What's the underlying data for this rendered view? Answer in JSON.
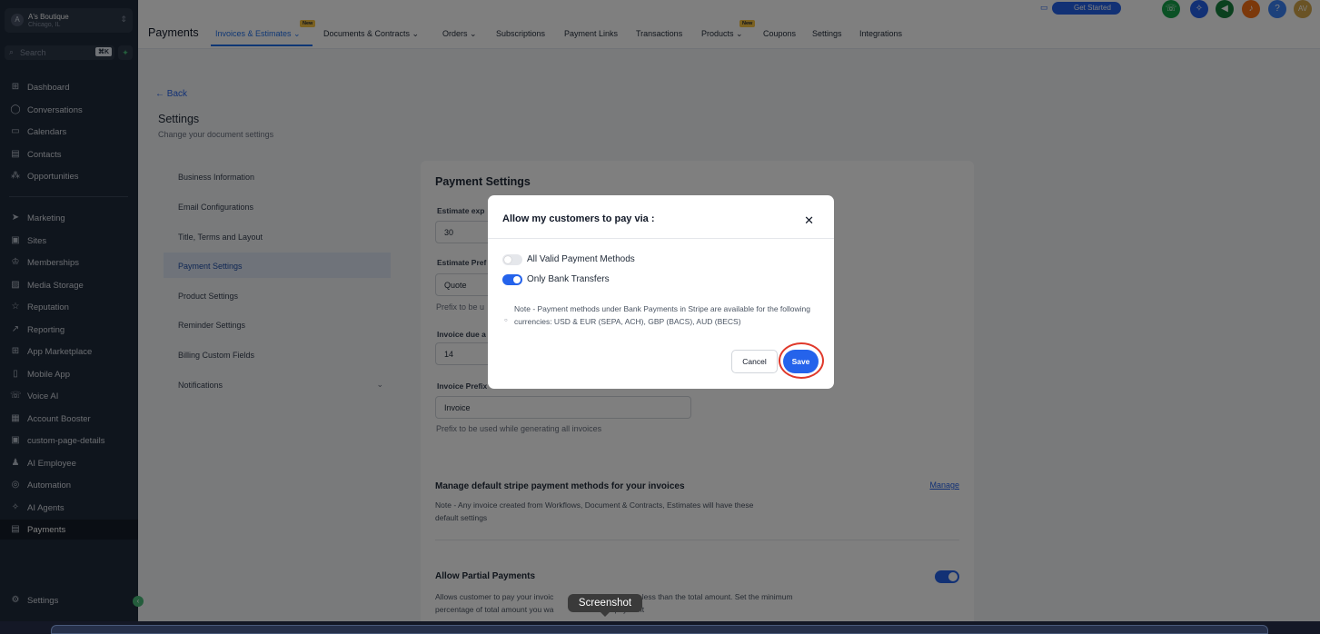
{
  "account": {
    "name": "A's Boutique",
    "location": "Chicago, IL",
    "avatar": "A"
  },
  "search": {
    "placeholder": "Search",
    "shortcut": "⌘K"
  },
  "sidebar": {
    "items": [
      {
        "label": "Dashboard",
        "icon": "⊞"
      },
      {
        "label": "Conversations",
        "icon": "◯"
      },
      {
        "label": "Calendars",
        "icon": "▭"
      },
      {
        "label": "Contacts",
        "icon": "▤"
      },
      {
        "label": "Opportunities",
        "icon": "⁂"
      },
      {
        "label": "Marketing",
        "icon": "➤"
      },
      {
        "label": "Sites",
        "icon": "▣"
      },
      {
        "label": "Memberships",
        "icon": "♔"
      },
      {
        "label": "Media Storage",
        "icon": "▨"
      },
      {
        "label": "Reputation",
        "icon": "☆"
      },
      {
        "label": "Reporting",
        "icon": "↗"
      },
      {
        "label": "App Marketplace",
        "icon": "⊞"
      },
      {
        "label": "Mobile App",
        "icon": "▯"
      },
      {
        "label": "Voice AI",
        "icon": "☏"
      },
      {
        "label": "Account Booster",
        "icon": "▦"
      },
      {
        "label": "custom-page-details",
        "icon": "▣"
      },
      {
        "label": "AI Employee",
        "icon": "♟"
      },
      {
        "label": "Automation",
        "icon": "◎"
      },
      {
        "label": "AI Agents",
        "icon": "✧"
      },
      {
        "label": "Payments",
        "icon": "▤"
      }
    ],
    "settings_label": "Settings"
  },
  "topbar": {
    "title": "Payments",
    "tabs": [
      {
        "label": "Invoices & Estimates",
        "dropdown": true,
        "new": true
      },
      {
        "label": "Documents & Contracts",
        "dropdown": true
      },
      {
        "label": "Orders",
        "dropdown": true
      },
      {
        "label": "Subscriptions"
      },
      {
        "label": "Payment Links"
      },
      {
        "label": "Transactions"
      },
      {
        "label": "Products",
        "dropdown": true,
        "new": true
      },
      {
        "label": "Coupons"
      },
      {
        "label": "Settings"
      },
      {
        "label": "Integrations"
      }
    ],
    "new_badge": "New",
    "get_started": "Get Started",
    "avatar_initials": "AV",
    "help": "?"
  },
  "settings": {
    "back": "Back",
    "title": "Settings",
    "subtitle": "Change your document settings",
    "menu": [
      "Business Information",
      "Email Configurations",
      "Title, Terms and Layout",
      "Payment Settings",
      "Product Settings",
      "Reminder Settings",
      "Billing Custom Fields",
      "Notifications"
    ]
  },
  "payment_settings": {
    "title": "Payment Settings",
    "estimate_expiry_label": "Estimate exp",
    "estimate_expiry_value": "30",
    "estimate_prefix_label": "Estimate Pref",
    "estimate_prefix_value": "Quote",
    "estimate_prefix_hint": "Prefix to be u",
    "invoice_due_label": "Invoice due a",
    "invoice_due_value": "14",
    "invoice_prefix_label": "Invoice Prefix",
    "invoice_prefix_value": "Invoice",
    "invoice_prefix_hint": "Prefix to be used while generating all invoices",
    "stripe_title": "Manage default stripe payment methods for your invoices",
    "stripe_note": "Note - Any invoice created from Workflows, Document & Contracts, Estimates will have these default settings",
    "manage_link": "Manage",
    "partial_title": "Allow Partial Payments",
    "partial_note_1": "Allows customer to pay your invoic",
    "partial_note_1b": "y amount less than the total amount. Set the minimum",
    "partial_note_2": "percentage of total amount you wa",
    "partial_note_2b": "n payment"
  },
  "modal": {
    "title": "Allow my customers to pay via :",
    "options": [
      {
        "label": "All Valid Payment Methods",
        "on": false
      },
      {
        "label": "Only Bank Transfers",
        "on": true
      }
    ],
    "note": "Note - Payment methods under Bank Payments in Stripe are available for the following currencies: USD & EUR (SEPA, ACH), GBP (BACS), AUD (BECS)",
    "cancel": "Cancel",
    "save": "Save"
  },
  "tooltip": "Screenshot",
  "colors": {
    "accent": "#2563eb",
    "sidebar": "#1f2a3b",
    "highlight_ring": "#e0392b"
  }
}
